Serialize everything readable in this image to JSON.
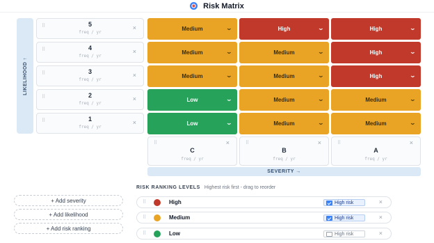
{
  "app": {
    "title": "Risk Matrix"
  },
  "colors": {
    "high": "#c0392b",
    "medium": "#e9a426",
    "low": "#27a25a",
    "axis": "#dbe8f6"
  },
  "axes": {
    "likelihood_label": "LIKELIHOOD ↑",
    "severity_label": "SEVERITY →"
  },
  "likelihood": [
    {
      "label": "5",
      "placeholder": "freq / yr"
    },
    {
      "label": "4",
      "placeholder": "freq / yr"
    },
    {
      "label": "3",
      "placeholder": "freq / yr"
    },
    {
      "label": "2",
      "placeholder": "freq / yr"
    },
    {
      "label": "1",
      "placeholder": "freq / yr"
    }
  ],
  "severity": [
    {
      "label": "C",
      "placeholder": "freq / yr"
    },
    {
      "label": "B",
      "placeholder": "freq / yr"
    },
    {
      "label": "A",
      "placeholder": "freq / yr"
    }
  ],
  "matrix": [
    [
      "Medium",
      "High",
      "High"
    ],
    [
      "Medium",
      "Medium",
      "High"
    ],
    [
      "Medium",
      "Medium",
      "High"
    ],
    [
      "Low",
      "Medium",
      "Medium"
    ],
    [
      "Low",
      "Medium",
      "Medium"
    ]
  ],
  "actions": {
    "add_severity": "+ Add severity",
    "add_likelihood": "+ Add likelihood",
    "add_ranking": "+ Add risk ranking"
  },
  "ranking": {
    "heading": "RISK RANKING LEVELS",
    "subtitle": "Highest risk first - drag to reorder",
    "levels": [
      {
        "name": "High",
        "color": "#c0392b",
        "high_risk": true,
        "checkbox_label": "High risk"
      },
      {
        "name": "Medium",
        "color": "#e9a426",
        "high_risk": true,
        "checkbox_label": "High risk"
      },
      {
        "name": "Low",
        "color": "#27a25a",
        "high_risk": false,
        "checkbox_label": "High risk"
      }
    ]
  },
  "icons": {
    "grip": "⠿",
    "close": "×",
    "chevron": "⌄"
  }
}
